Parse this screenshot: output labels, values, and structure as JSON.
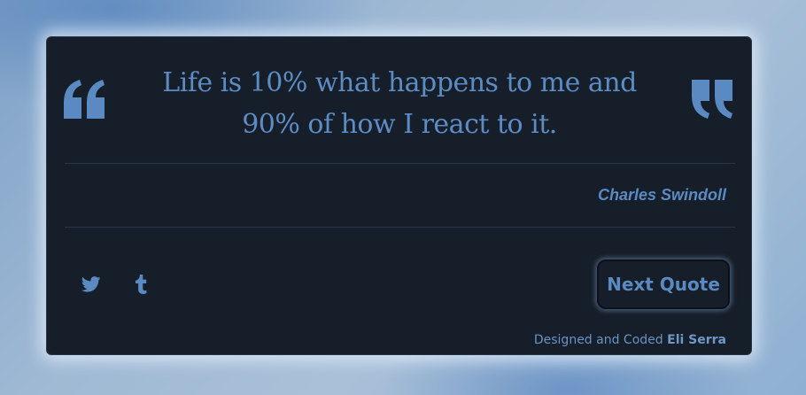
{
  "quote": {
    "text": "Life is 10% what happens to me and 90% of how I react to it.",
    "author": "Charles Swindoll",
    "open_mark_icon": "open-quote-icon",
    "close_mark_icon": "close-quote-icon"
  },
  "social": {
    "twitter_icon": "twitter-icon",
    "tumblr_icon": "tumblr-icon"
  },
  "actions": {
    "next_label": "Next Quote"
  },
  "footer": {
    "credit_prefix": "Designed and Coded",
    "credit_name": "Eli Serra"
  },
  "colors": {
    "card_background": "#151e29",
    "accent": "#5b8ac2",
    "page_background": "#9fb9d4"
  }
}
